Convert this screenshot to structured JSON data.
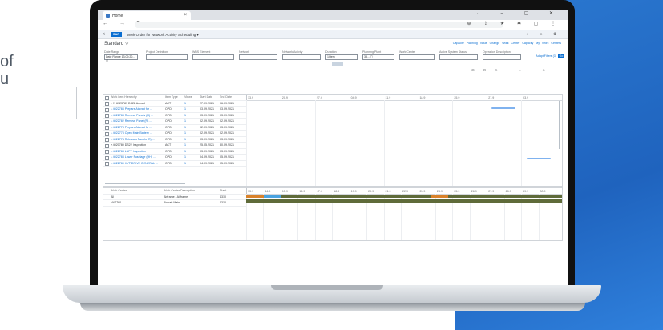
{
  "background": {
    "left_text_1": "of",
    "left_text_2": "u",
    "accent_color": "#2b79d1"
  },
  "browser": {
    "tab_title": "Home",
    "tab_close": "×",
    "new_tab": "+",
    "window_buttons": "⌄ – ▢ ✕",
    "nav_icons": "← → C",
    "addr_icons": "⊕ ⇪ ★ ✱ ▢ ⋮"
  },
  "shell": {
    "back": "<",
    "logo": "SAP",
    "app_title": "Work Order for Network Activity Scheduling ▾",
    "icons": "⌕ ☺ ◉"
  },
  "header": {
    "variant": "Standard ▽",
    "links": [
      "Capacity Planning Value",
      "Change Work Center Capacity",
      "My Work Centers"
    ]
  },
  "filters": [
    {
      "label": "Date Range",
      "value": "Date Range 13.09.20... ▢"
    },
    {
      "label": "Project Definition",
      "value": ""
    },
    {
      "label": "WBS Element",
      "value": ""
    },
    {
      "label": "Network",
      "value": ""
    },
    {
      "label": "Network Activity",
      "value": ""
    },
    {
      "label": "Duration",
      "value": "1 Item"
    },
    {
      "label": "Planning Plant",
      "value": "33... ▢"
    },
    {
      "label": "Work Center",
      "value": ""
    },
    {
      "label": "Active System Status",
      "value": ""
    },
    {
      "label": "Operation Description",
      "value": ""
    }
  ],
  "filter_actions": {
    "adapt": "Adapt Filters (3)",
    "go": "Go"
  },
  "toolbar_icons": "⊞ ⊟ ⊖ ──○── ⊕ ⋯",
  "upper_table": {
    "headers": [
      "Work Item Hierarchy",
      "Item Type",
      "Views",
      "Start Date",
      "End Date"
    ],
    "rows": [
      {
        "name": "▾ ☐ 6123789 DS22 Annual",
        "type": "ACT",
        "views": "1",
        "start": "27.09.2021",
        "end": "06.09.2021",
        "link": false
      },
      {
        "name": "▸ 4022783 Prepare Aircraft for ...",
        "type": "OPD",
        "views": "1",
        "start": "03.09.2021",
        "end": "03.09.2021",
        "link": true
      },
      {
        "name": "▸ 4022783 Remove Panels (R) ...",
        "type": "OPD",
        "views": "1",
        "start": "03.09.2021",
        "end": "03.09.2021",
        "link": true
      },
      {
        "name": "▸ 4022782 Remove Panel (R) ...",
        "type": "OPD",
        "views": "1",
        "start": "02.09.2021",
        "end": "02.09.2021",
        "link": true
      },
      {
        "name": "▸ 4022773 Prepare Aircraft fo ...",
        "type": "OPD",
        "views": "1",
        "start": "02.09.2021",
        "end": "03.09.2021",
        "link": true
      },
      {
        "name": "▸ 4022773 Open Main Battery ...",
        "type": "OPD",
        "views": "1",
        "start": "02.09.2021",
        "end": "02.09.2021",
        "link": true
      },
      {
        "name": "▸ 4022774 Releases Panels (R) ...",
        "type": "OPD",
        "views": "1",
        "start": "03.09.2021",
        "end": "03.09.2021",
        "link": true
      },
      {
        "name": "▾ 4020780 DS22 Inspection",
        "type": "ACT",
        "views": "1",
        "start": "25.05.2021",
        "end": "30.09.2021",
        "link": false
      },
      {
        "name": "▸ 4022783 LUFT Inspection",
        "type": "OPD",
        "views": "1",
        "start": "03.09.2021",
        "end": "03.09.2021",
        "link": true
      },
      {
        "name": "▸ 4022783 Lower Fuselage (HH) ...",
        "type": "OPD",
        "views": "1",
        "start": "04.09.2021",
        "end": "05.09.2021",
        "link": true
      },
      {
        "name": "▸ 4022780 HYT DRIVE GENERAL ...",
        "type": "OPD",
        "views": "1",
        "start": "04.09.2021",
        "end": "05.09.2021",
        "link": true
      }
    ]
  },
  "timeline_upper": [
    "13.9",
    "20.9",
    "27.9",
    "04.9",
    "11.9",
    "18.9",
    "25.9",
    "27.9",
    "03.9"
  ],
  "timeline_lower": [
    "13.9",
    "14.9",
    "15.9",
    "16.9",
    "17.9",
    "18.9",
    "19.9",
    "20.9",
    "21.9",
    "22.9",
    "23.9",
    "24.9",
    "25.9",
    "26.9",
    "27.9",
    "28.9",
    "29.9",
    "30.9"
  ],
  "lower_table": {
    "headers": [
      "Work Center",
      "Work Center Description",
      "Plant"
    ],
    "rows": [
      {
        "wc": "All",
        "desc": "Airframe - Airframe",
        "plant": "4310"
      },
      {
        "wc": "HYT760",
        "desc": "Aircraft Main",
        "plant": "4310"
      }
    ]
  },
  "colors": {
    "bar": "#7fb2ef",
    "util_base": "#5f6b3a",
    "util_orange": "#d9822b",
    "util_blue": "#4aa3e0"
  }
}
